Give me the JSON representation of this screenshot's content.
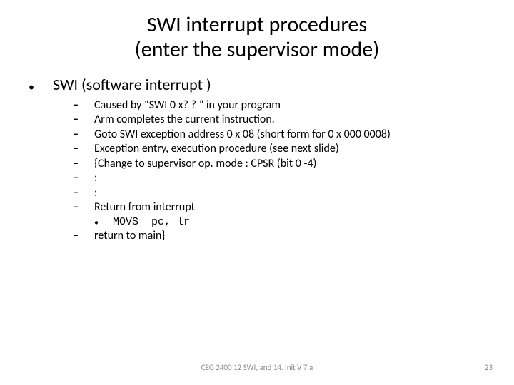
{
  "title_line1": "SWI interrupt procedures",
  "title_line2": "(enter the supervisor mode)",
  "lvl1_text": "SWI (software interrupt )",
  "items": [
    "Caused by “SWI 0 x? ? ” in your program",
    "Arm completes the current instruction.",
    "Goto SWI exception address 0 x 08 (short form for  0 x 000 0008)",
    "Exception entry, execution procedure (see next slide)",
    "{Change to supervisor op. mode : CPSR (bit 0 -4)",
    ":",
    ":",
    "Return from interrupt"
  ],
  "sub_item": "MOVS  pc, lr",
  "last_item": "return to main}",
  "footer_center": "CEG 2400 12 SWI, and 14. init V 7 a",
  "footer_right": "23"
}
